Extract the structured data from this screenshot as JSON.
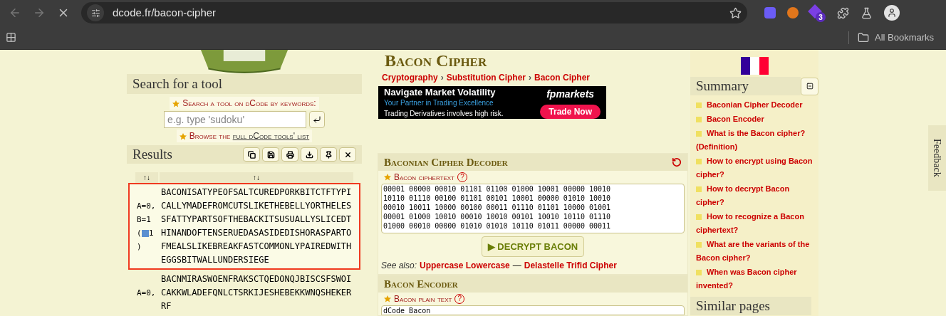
{
  "browser": {
    "url": "dcode.fr/bacon-cipher",
    "extension_badge": "3",
    "bookmarks_label": "All Bookmarks"
  },
  "left": {
    "search_title": "Search for a tool",
    "search_label": "Search a tool on dCode by keywords:",
    "search_placeholder": "e.g. type 'sudoku'",
    "browse_prefix": "Browse the",
    "browse_link": "full dCode tools' list",
    "results_title": "Results",
    "columns": [
      "↑↓",
      "↑↓"
    ],
    "rows": [
      {
        "key_before": "A=0, B=1 (",
        "key_after": "1 )",
        "text": "BACONISATYPEOFSALTCUREDPORKBITCTFTYPICALLYMADEFROMCUTSLIKETHEBELLYORTHELESSFATTYPARTSOFTHEBACKITSUSUALLYSLICEDTHINANDOFTENSERUEDASASIDEDISHORASPARTOFMEALSLIKEBREAKFASTCOMMONLYPAIREDWITHEGGSBITWALLUNDERSIEGE",
        "selected": true
      },
      {
        "key_before": "A=0,",
        "key_after": "",
        "text": "BACNMIRASWOENFRAKSCTQEDONQJBISCSFSWOICAKKWLADEFQNLCTSRKIJESHEBEKKWNQSHEKERRF",
        "selected": false
      }
    ]
  },
  "main": {
    "title": "Bacon Cipher",
    "breadcrumb": [
      "Cryptography",
      "Substitution Cipher",
      "Bacon Cipher"
    ],
    "breadcrumb_separator": "›",
    "help_mark": "?",
    "ad": {
      "headline": "Navigate Market Volatility",
      "tagline": "Your Partner in Trading Excellence",
      "risk": "Trading Derivatives involves high risk.",
      "brand": "fpmarkets",
      "cta": "Trade Now"
    },
    "decoder": {
      "title": "Baconian Cipher Decoder",
      "field_label": "Bacon ciphertext",
      "ciphertext": "00001 00000 00010 01101 01100 01000 10001 00000 10010\n10110 01110 00100 01101 00101 10001 00000 01010 10010\n00010 10011 10000 00100 00011 01110 01101 10000 01001\n00001 01000 10010 00010 10010 00101 10010 10110 01110\n01000 00010 00000 01010 01010 10110 01011 00000 00011",
      "button": "▶ DECRYPT BACON",
      "see_also_label": "See also:",
      "see_also": [
        "Uppercase Lowercase",
        "Delastelle Trifid Cipher"
      ],
      "separator": "—"
    },
    "encoder": {
      "title": "Bacon Encoder",
      "field_label": "Bacon plain text",
      "value": "dCode Bacon"
    }
  },
  "right": {
    "summary_title": "Summary",
    "summary": [
      "Baconian Cipher Decoder",
      "Bacon Encoder",
      "What is the Bacon cipher? (Definition)",
      "How to encrypt using Bacon cipher?",
      "How to decrypt Bacon cipher?",
      "How to recognize a Bacon ciphertext?",
      "What are the variants of the Bacon cipher?",
      "When was Bacon cipher invented?"
    ],
    "similar_title": "Similar pages"
  },
  "feedback": "Feedback"
}
